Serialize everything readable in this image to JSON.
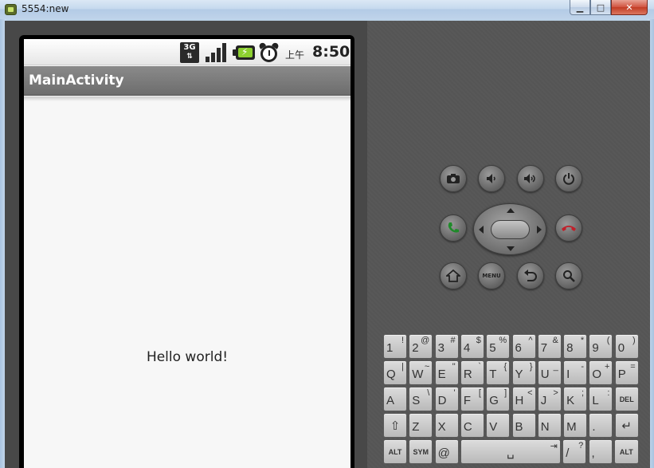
{
  "window": {
    "title": "5554:new"
  },
  "status_bar": {
    "network": "3G",
    "ampm": "上午",
    "time": "8:50"
  },
  "app": {
    "action_bar_title": "MainActivity",
    "content_text": "Hello world!"
  },
  "keyboard": {
    "rows": [
      [
        {
          "main": "1",
          "alt": "!"
        },
        {
          "main": "2",
          "alt": "@"
        },
        {
          "main": "3",
          "alt": "#"
        },
        {
          "main": "4",
          "alt": "$"
        },
        {
          "main": "5",
          "alt": "%"
        },
        {
          "main": "6",
          "alt": "^"
        },
        {
          "main": "7",
          "alt": "&"
        },
        {
          "main": "8",
          "alt": "*"
        },
        {
          "main": "9",
          "alt": "("
        },
        {
          "main": "0",
          "alt": ")"
        }
      ],
      [
        {
          "main": "Q",
          "alt": "|"
        },
        {
          "main": "W",
          "alt": "~"
        },
        {
          "main": "E",
          "alt": "\""
        },
        {
          "main": "R",
          "alt": "`"
        },
        {
          "main": "T",
          "alt": "{"
        },
        {
          "main": "Y",
          "alt": "}"
        },
        {
          "main": "U",
          "alt": "_"
        },
        {
          "main": "I",
          "alt": "-"
        },
        {
          "main": "O",
          "alt": "+"
        },
        {
          "main": "P",
          "alt": "="
        }
      ],
      [
        {
          "main": "A",
          "alt": ""
        },
        {
          "main": "S",
          "alt": "\\"
        },
        {
          "main": "D",
          "alt": "'"
        },
        {
          "main": "F",
          "alt": "["
        },
        {
          "main": "G",
          "alt": "]"
        },
        {
          "main": "H",
          "alt": "<"
        },
        {
          "main": "J",
          "alt": ">"
        },
        {
          "main": "K",
          "alt": ";"
        },
        {
          "main": "L",
          "alt": ":"
        },
        {
          "main": "DEL",
          "alt": ""
        }
      ],
      [
        {
          "main": "⇧",
          "alt": ""
        },
        {
          "main": "Z",
          "alt": ""
        },
        {
          "main": "X",
          "alt": ""
        },
        {
          "main": "C",
          "alt": ""
        },
        {
          "main": "V",
          "alt": ""
        },
        {
          "main": "B",
          "alt": ""
        },
        {
          "main": "N",
          "alt": ""
        },
        {
          "main": "M",
          "alt": ""
        },
        {
          "main": ".",
          "alt": ""
        },
        {
          "main": "↵",
          "alt": ""
        }
      ],
      [
        {
          "main": "ALT",
          "alt": ""
        },
        {
          "main": "SYM",
          "alt": ""
        },
        {
          "main": "@",
          "alt": ""
        },
        {
          "main": "␣",
          "alt": "⇥"
        },
        {
          "main": "/",
          "alt": "?"
        },
        {
          "main": ",",
          "alt": ""
        },
        {
          "main": "ALT",
          "alt": ""
        }
      ]
    ]
  },
  "controls": {
    "menu_label": "MENU",
    "icons": [
      "camera-icon",
      "volume-down-icon",
      "volume-up-icon",
      "power-icon",
      "call-icon",
      "end-call-icon",
      "home-icon",
      "back-icon",
      "search-icon"
    ]
  },
  "colors": {
    "call_green": "#1f8a2a",
    "end_call_red": "#c0202a",
    "battery_green": "#8ccf2f"
  }
}
